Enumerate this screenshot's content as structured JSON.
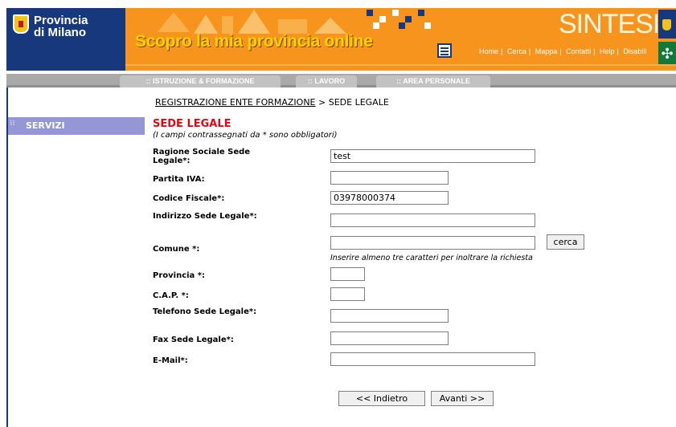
{
  "header": {
    "province_line1": "Provincia",
    "province_line2": "di Milano",
    "banner": "Scopro la mia provincia online",
    "brand": "SINTESI",
    "nav": [
      "Home",
      "Cerca",
      "Mappa",
      "Contatti",
      "Help",
      "Disabili"
    ]
  },
  "tabs": [
    ":: ISTRUZIONE & FORMAZIONE",
    ":: LAVORO",
    ":: AREA PERSONALE"
  ],
  "sidebar": {
    "servizi": "SERVIZI"
  },
  "breadcrumb": {
    "link": "REGISTRAZIONE ENTE FORMAZIONE",
    "sep": ">",
    "current": "SEDE LEGALE"
  },
  "form": {
    "title": "SEDE LEGALE",
    "subtitle": "(I campi contrassegnati da * sono obbligatori)",
    "fields": [
      {
        "label": "Ragione Sociale Sede Legale*:",
        "value": "test"
      },
      {
        "label": "Partita IVA:",
        "value": ""
      },
      {
        "label": "Codice Fiscale*:",
        "value": "03978000374"
      },
      {
        "label": "Indirizzo Sede Legale*:",
        "value": ""
      },
      {
        "label": "Comune *:",
        "value": ""
      },
      {
        "label": "Provincia *:",
        "value": ""
      },
      {
        "label": "C.A.P. *:",
        "value": ""
      },
      {
        "label": "Telefono Sede Legale*:",
        "value": ""
      },
      {
        "label": "Fax Sede Legale*:",
        "value": ""
      },
      {
        "label": "E-Mail*:",
        "value": ""
      }
    ],
    "cerca_button": "cerca",
    "comune_hint": "Inserire almeno tre caratteri per inoltrare la richiesta",
    "back_button": "<< Indietro",
    "next_button": "Avanti >>"
  },
  "colors": {
    "header_orange": "#f7941d",
    "province_blue": "#17387c",
    "title_red": "#e30613",
    "sidebar_purple": "#9496d6"
  }
}
